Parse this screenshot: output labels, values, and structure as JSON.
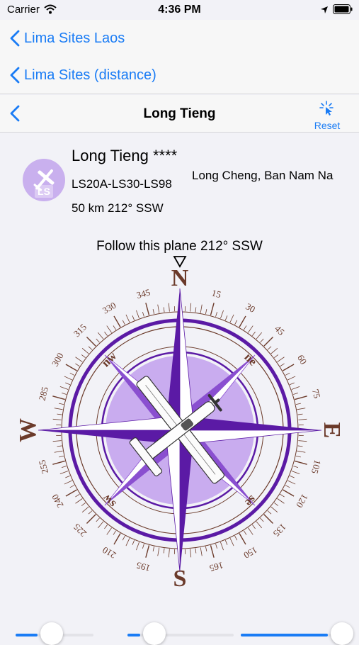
{
  "status_bar": {
    "carrier": "Carrier",
    "time": "4:36 PM"
  },
  "nav": {
    "row1_back_label": "Lima Sites Laos",
    "row2_back_label": "Lima Sites (distance)",
    "title": "Long Tieng",
    "reset_label": "Reset"
  },
  "site": {
    "icon_text": "LS",
    "name": "Long Tieng ****",
    "codes": "LS20A-LS30-LS98",
    "place": "Long Cheng, Ban Nam Na",
    "distance": "50 km 212° SSW"
  },
  "compass": {
    "follow_text": "Follow this plane 212° SSW",
    "pointer_glyph": "▽",
    "cardinals": {
      "N": "N",
      "E": "E",
      "S": "S",
      "W": "W"
    },
    "intercardinals": {
      "ne": "ne",
      "se": "se",
      "sw": "sw",
      "nw": "nw"
    },
    "degree_labels": [
      "15",
      "30",
      "45",
      "60",
      "75",
      "105",
      "120",
      "135",
      "150",
      "165",
      "195",
      "210",
      "225",
      "240",
      "255",
      "285",
      "300",
      "315",
      "330",
      "345"
    ],
    "heading_deg": 212,
    "colors": {
      "purple": "#5b1aa5",
      "brown": "#6b3a2a",
      "disk": "#c6a6ee",
      "icon_bg": "#c9b0ee"
    }
  },
  "sliders": [
    {
      "level": 0.28
    },
    {
      "level": 0.12
    },
    {
      "level": 0.88
    }
  ]
}
